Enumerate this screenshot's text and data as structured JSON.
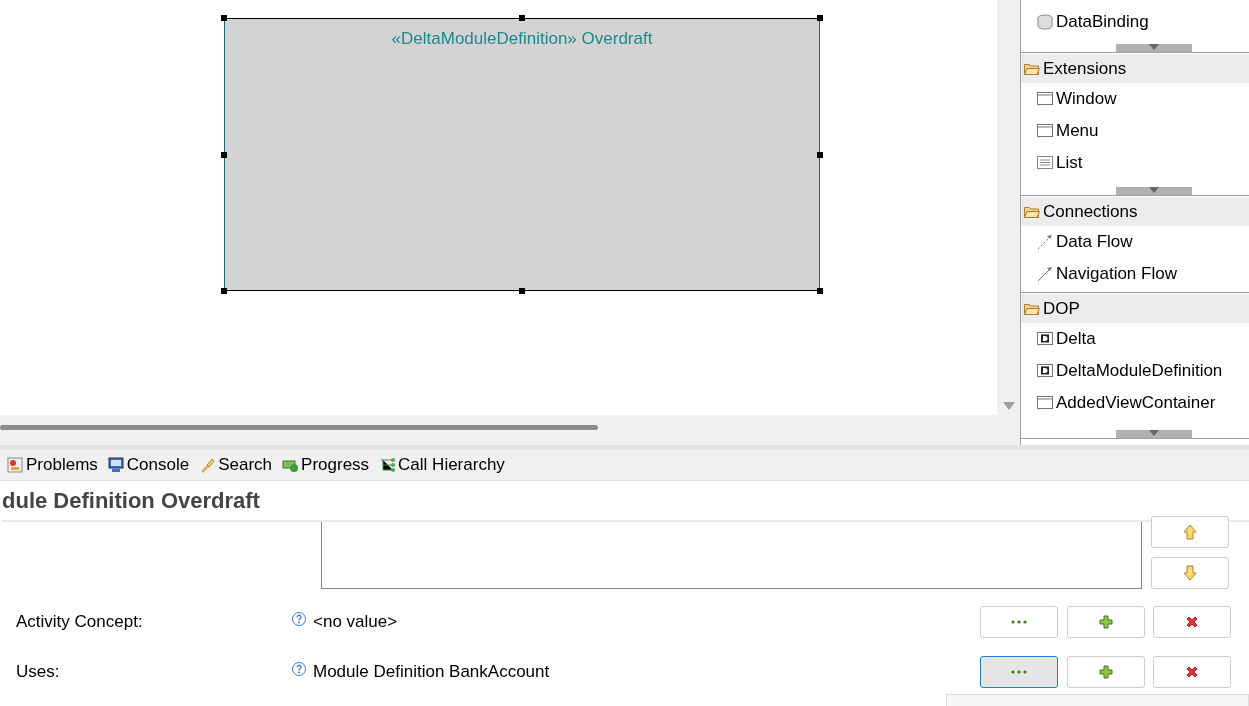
{
  "diagram": {
    "element_label": "«DeltaModuleDefinition» Overdraft",
    "selected": true
  },
  "palette": {
    "sections": [
      {
        "items": [
          {
            "label": "DataBinding",
            "kind": "database"
          }
        ],
        "more_below": true
      },
      {
        "title": "Extensions",
        "items": [
          {
            "label": "Window",
            "kind": "window"
          },
          {
            "label": "Menu",
            "kind": "window"
          },
          {
            "label": "List",
            "kind": "list"
          }
        ],
        "more_below": true
      },
      {
        "title": "Connections",
        "items": [
          {
            "label": "Data Flow",
            "kind": "dashed-arrow"
          },
          {
            "label": "Navigation Flow",
            "kind": "arrow"
          }
        ],
        "more_below": false
      },
      {
        "title": "DOP",
        "items": [
          {
            "label": "Delta",
            "kind": "delta"
          },
          {
            "label": "DeltaModuleDefinition",
            "kind": "delta"
          },
          {
            "label": "AddedViewContainer",
            "kind": "window"
          }
        ],
        "more_below": true
      }
    ]
  },
  "bottom_tabs": [
    {
      "label": "Problems",
      "kind": "problems"
    },
    {
      "label": "Console",
      "kind": "console"
    },
    {
      "label": "Search",
      "kind": "search"
    },
    {
      "label": "Progress",
      "kind": "progress"
    },
    {
      "label": "Call Hierarchy",
      "kind": "hierarchy"
    }
  ],
  "properties": {
    "title": "dule Definition Overdraft",
    "rows": [
      {
        "label": "Activity Concept:",
        "value": "<no value>",
        "focused": false
      },
      {
        "label": "Uses:",
        "value": "Module Definition BankAccount",
        "focused": true
      }
    ]
  }
}
